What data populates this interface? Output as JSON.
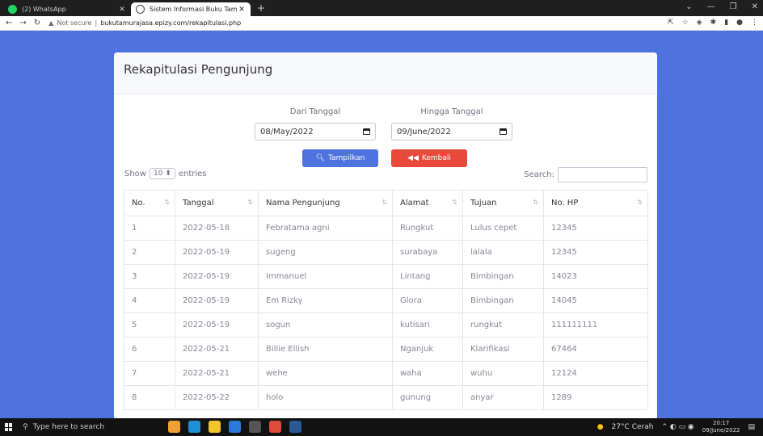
{
  "browser": {
    "tabs": [
      {
        "title": "(2) WhatsApp",
        "icon": "whatsapp-icon"
      },
      {
        "title": "Sistem Informasi Buku Tamu",
        "icon": "globe-icon"
      }
    ],
    "security": "Not secure",
    "url": "bukutamurajasa.epizy.com/rekapitulasi.php"
  },
  "page": {
    "title": "Rekapitulasi Pengunjung",
    "filter": {
      "from_label": "Dari Tanggal",
      "from_value": "08/May/2022",
      "to_label": "Hingga Tanggal",
      "to_value": "09/June/2022"
    },
    "buttons": {
      "show": "Tampilkan",
      "back": "Kembali"
    },
    "length": {
      "show": "Show",
      "value": "10",
      "entries": "entries"
    },
    "search_label": "Search:",
    "columns": [
      "No.",
      "Tanggal",
      "Nama Pengunjung",
      "Alamat",
      "Tujuan",
      "No. HP"
    ],
    "rows": [
      [
        "1",
        "2022-05-18",
        "Febratama agni",
        "Rungkut",
        "Lulus cepet",
        "12345"
      ],
      [
        "2",
        "2022-05-19",
        "sugeng",
        "surabaya",
        "lalala",
        "12345"
      ],
      [
        "3",
        "2022-05-19",
        "Immanuel",
        "Lintang",
        "Bimbingan",
        "14023"
      ],
      [
        "4",
        "2022-05-19",
        "Em Rizky",
        "Glora",
        "Bimbingan",
        "14045"
      ],
      [
        "5",
        "2022-05-19",
        "sogun",
        "kutisari",
        "rungkut",
        "111111111"
      ],
      [
        "6",
        "2022-05-21",
        "Billie Ellish",
        "Nganjuk",
        "Klarifikasi",
        "67464"
      ],
      [
        "7",
        "2022-05-21",
        "wehe",
        "waha",
        "wuhu",
        "12124"
      ],
      [
        "8",
        "2022-05-22",
        "holo",
        "gunung",
        "anyar",
        "1289"
      ]
    ]
  },
  "taskbar": {
    "search_placeholder": "Type here to search",
    "weather": "27°C  Cerah",
    "time": "20:17",
    "date": "09/June/2022"
  },
  "colors": {
    "primary": "#4e73df",
    "danger": "#e74a3b"
  }
}
